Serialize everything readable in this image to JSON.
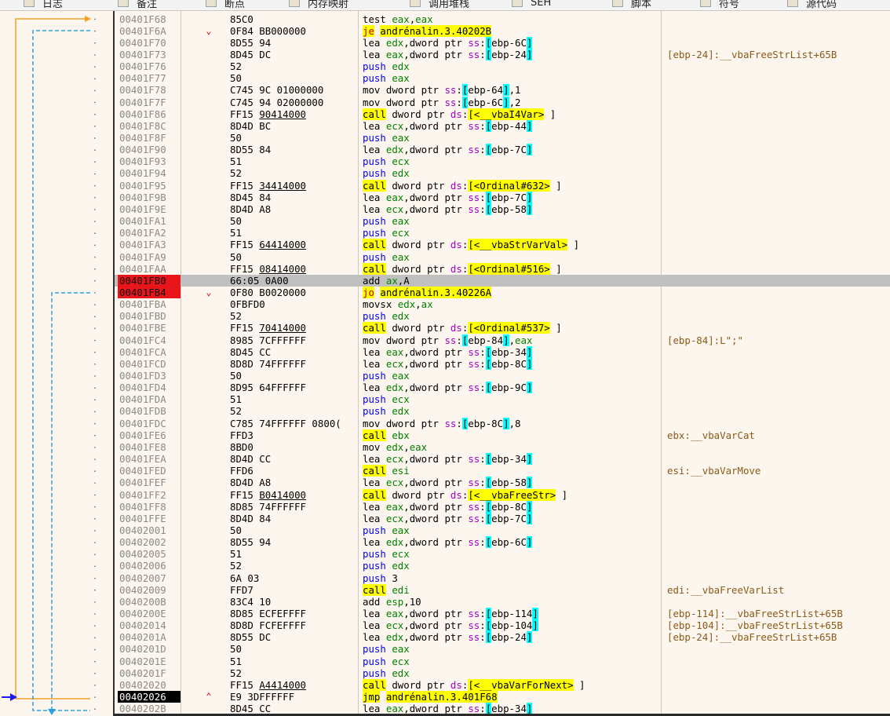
{
  "toolbar": {
    "items": [
      {
        "label": "日志",
        "icon": "log-icon"
      },
      {
        "label": "备注",
        "icon": "notes-icon"
      },
      {
        "label": "断点",
        "icon": "breakpoint-icon"
      },
      {
        "label": "内存映射",
        "icon": "memory-map-icon"
      },
      {
        "label": "调用堆栈",
        "icon": "call-stack-icon"
      },
      {
        "label": "SEH",
        "icon": "seh-icon"
      },
      {
        "label": "脚本",
        "icon": "script-icon"
      },
      {
        "label": "符号",
        "icon": "symbols-icon"
      },
      {
        "label": "源代码",
        "icon": "source-icon"
      }
    ]
  },
  "colors": {
    "background": "#fdf6ee",
    "breakpoint": "#e8151b",
    "eip": "#000000",
    "current_row": "#c0c0c0",
    "call_highlight": "#ffff00",
    "jump_arrow": "#f0a020",
    "branch_arrow": "#2aa0e8",
    "eip_arrow": "#1a1aff"
  },
  "rows": [
    {
      "addr": "00401F68",
      "bytes": "85C0",
      "m": "test",
      "ops": [
        [
          "reg",
          "eax"
        ],
        [
          "kw",
          ","
        ],
        [
          "reg",
          "eax"
        ]
      ],
      "mc": "m-test"
    },
    {
      "addr": "00401F6A",
      "bytes": "0F84 BB000000",
      "m": "je",
      "ops": [
        [
          "tgt",
          "andrénalin.3.40202B"
        ]
      ],
      "mc": "m-jcc",
      "mark": "⌄",
      "tgt_hl": true
    },
    {
      "addr": "00401F70",
      "bytes": "8D55 94",
      "m": "lea",
      "ops": [
        [
          "reg",
          "edx"
        ],
        [
          "kw",
          ",dword ptr  "
        ],
        [
          "seg",
          "ss"
        ],
        [
          "kw",
          ":"
        ],
        [
          "br",
          "[ebp-6C]"
        ]
      ],
      "mc": "m-lea"
    },
    {
      "addr": "00401F73",
      "bytes": "8D45 DC",
      "m": "lea",
      "ops": [
        [
          "reg",
          "eax"
        ],
        [
          "kw",
          ",dword ptr  "
        ],
        [
          "seg",
          "ss"
        ],
        [
          "kw",
          ":"
        ],
        [
          "br",
          "[ebp-24]"
        ]
      ],
      "mc": "m-lea",
      "cmt": "[ebp-24]:__vbaFreeStrList+65B"
    },
    {
      "addr": "00401F76",
      "bytes": "52",
      "m": "push",
      "ops": [
        [
          "reg",
          "edx"
        ]
      ],
      "mc": "m-push"
    },
    {
      "addr": "00401F77",
      "bytes": "50",
      "m": "push",
      "ops": [
        [
          "reg",
          "eax"
        ]
      ],
      "mc": "m-push"
    },
    {
      "addr": "00401F78",
      "bytes": "C745 9C 01000000",
      "m": "mov",
      "ops": [
        [
          "kw",
          "dword ptr  "
        ],
        [
          "seg",
          "ss"
        ],
        [
          "kw",
          ":"
        ],
        [
          "br",
          "[ebp-64]"
        ],
        [
          "kw",
          ",1"
        ]
      ],
      "mc": "m-mov"
    },
    {
      "addr": "00401F7F",
      "bytes": "C745 94 02000000",
      "m": "mov",
      "ops": [
        [
          "kw",
          "dword ptr  "
        ],
        [
          "seg",
          "ss"
        ],
        [
          "kw",
          ":"
        ],
        [
          "br",
          "[ebp-6C]"
        ],
        [
          "kw",
          ",2"
        ]
      ],
      "mc": "m-mov"
    },
    {
      "addr": "00401F86",
      "bytes": "FF15 ",
      "bu": "90414000",
      "m": "call",
      "ops": [
        [
          "kw",
          "dword ptr  "
        ],
        [
          "seg",
          "ds"
        ],
        [
          "kw",
          ":"
        ],
        [
          "api",
          "[<__vbaI4Var>"
        ],
        [
          "kw",
          " ]"
        ]
      ],
      "mc": "m-call"
    },
    {
      "addr": "00401F8C",
      "bytes": "8D4D BC",
      "m": "lea",
      "ops": [
        [
          "reg",
          "ecx"
        ],
        [
          "kw",
          ",dword ptr  "
        ],
        [
          "seg",
          "ss"
        ],
        [
          "kw",
          ":"
        ],
        [
          "br",
          "[ebp-44]"
        ]
      ],
      "mc": "m-lea"
    },
    {
      "addr": "00401F8F",
      "bytes": "50",
      "m": "push",
      "ops": [
        [
          "reg",
          "eax"
        ]
      ],
      "mc": "m-push"
    },
    {
      "addr": "00401F90",
      "bytes": "8D55 84",
      "m": "lea",
      "ops": [
        [
          "reg",
          "edx"
        ],
        [
          "kw",
          ",dword ptr  "
        ],
        [
          "seg",
          "ss"
        ],
        [
          "kw",
          ":"
        ],
        [
          "br",
          "[ebp-7C]"
        ]
      ],
      "mc": "m-lea"
    },
    {
      "addr": "00401F93",
      "bytes": "51",
      "m": "push",
      "ops": [
        [
          "reg",
          "ecx"
        ]
      ],
      "mc": "m-push"
    },
    {
      "addr": "00401F94",
      "bytes": "52",
      "m": "push",
      "ops": [
        [
          "reg",
          "edx"
        ]
      ],
      "mc": "m-push"
    },
    {
      "addr": "00401F95",
      "bytes": "FF15 ",
      "bu": "34414000",
      "m": "call",
      "ops": [
        [
          "kw",
          "dword ptr  "
        ],
        [
          "seg",
          "ds"
        ],
        [
          "kw",
          ":"
        ],
        [
          "api",
          "[<Ordinal#632>"
        ],
        [
          "kw",
          " ]"
        ]
      ],
      "mc": "m-call"
    },
    {
      "addr": "00401F9B",
      "bytes": "8D45 84",
      "m": "lea",
      "ops": [
        [
          "reg",
          "eax"
        ],
        [
          "kw",
          ",dword ptr  "
        ],
        [
          "seg",
          "ss"
        ],
        [
          "kw",
          ":"
        ],
        [
          "br",
          "[ebp-7C]"
        ]
      ],
      "mc": "m-lea"
    },
    {
      "addr": "00401F9E",
      "bytes": "8D4D A8",
      "m": "lea",
      "ops": [
        [
          "reg",
          "ecx"
        ],
        [
          "kw",
          ",dword ptr  "
        ],
        [
          "seg",
          "ss"
        ],
        [
          "kw",
          ":"
        ],
        [
          "br",
          "[ebp-58]"
        ]
      ],
      "mc": "m-lea"
    },
    {
      "addr": "00401FA1",
      "bytes": "50",
      "m": "push",
      "ops": [
        [
          "reg",
          "eax"
        ]
      ],
      "mc": "m-push"
    },
    {
      "addr": "00401FA2",
      "bytes": "51",
      "m": "push",
      "ops": [
        [
          "reg",
          "ecx"
        ]
      ],
      "mc": "m-push"
    },
    {
      "addr": "00401FA3",
      "bytes": "FF15 ",
      "bu": "64414000",
      "m": "call",
      "ops": [
        [
          "kw",
          "dword ptr  "
        ],
        [
          "seg",
          "ds"
        ],
        [
          "kw",
          ":"
        ],
        [
          "api",
          "[<__vbaStrVarVal>"
        ],
        [
          "kw",
          " ]"
        ]
      ],
      "mc": "m-call"
    },
    {
      "addr": "00401FA9",
      "bytes": "50",
      "m": "push",
      "ops": [
        [
          "reg",
          "eax"
        ]
      ],
      "mc": "m-push"
    },
    {
      "addr": "00401FAA",
      "bytes": "FF15 ",
      "bu": "08414000",
      "m": "call",
      "ops": [
        [
          "kw",
          "dword ptr  "
        ],
        [
          "seg",
          "ds"
        ],
        [
          "kw",
          ":"
        ],
        [
          "api",
          "[<Ordinal#516>"
        ],
        [
          "kw",
          " ]"
        ]
      ],
      "mc": "m-call"
    },
    {
      "addr": "00401FB0",
      "bytes": "66:05 0A00",
      "m": "add",
      "ops": [
        [
          "reg",
          "ax"
        ],
        [
          "kw",
          ",A"
        ]
      ],
      "mc": "m-add",
      "bp": true,
      "cur": true
    },
    {
      "addr": "00401FB4",
      "bytes": "0F80 B0020000",
      "m": "jo",
      "ops": [
        [
          "tgt",
          "andrénalin.3.40226A"
        ]
      ],
      "mc": "m-jcc",
      "bp": true,
      "mark": "⌄",
      "tgt_hl": true
    },
    {
      "addr": "00401FBA",
      "bytes": "0FBFD0",
      "m": "movsx",
      "ops": [
        [
          "reg",
          "edx"
        ],
        [
          "kw",
          ","
        ],
        [
          "reg",
          "ax"
        ]
      ],
      "mc": "m-movsx"
    },
    {
      "addr": "00401FBD",
      "bytes": "52",
      "m": "push",
      "ops": [
        [
          "reg",
          "edx"
        ]
      ],
      "mc": "m-push"
    },
    {
      "addr": "00401FBE",
      "bytes": "FF15 ",
      "bu": "70414000",
      "m": "call",
      "ops": [
        [
          "kw",
          "dword ptr  "
        ],
        [
          "seg",
          "ds"
        ],
        [
          "kw",
          ":"
        ],
        [
          "api",
          "[<Ordinal#537>"
        ],
        [
          "kw",
          " ]"
        ]
      ],
      "mc": "m-call"
    },
    {
      "addr": "00401FC4",
      "bytes": "8985 7CFFFFFF",
      "m": "mov",
      "ops": [
        [
          "kw",
          "dword ptr  "
        ],
        [
          "seg",
          "ss"
        ],
        [
          "kw",
          ":"
        ],
        [
          "br",
          "[ebp-84]"
        ],
        [
          "kw",
          ","
        ],
        [
          "reg",
          "eax"
        ]
      ],
      "mc": "m-mov",
      "cmt": "[ebp-84]:L\";\""
    },
    {
      "addr": "00401FCA",
      "bytes": "8D45 CC",
      "m": "lea",
      "ops": [
        [
          "reg",
          "eax"
        ],
        [
          "kw",
          ",dword ptr  "
        ],
        [
          "seg",
          "ss"
        ],
        [
          "kw",
          ":"
        ],
        [
          "br",
          "[ebp-34]"
        ]
      ],
      "mc": "m-lea"
    },
    {
      "addr": "00401FCD",
      "bytes": "8D8D 74FFFFFF",
      "m": "lea",
      "ops": [
        [
          "reg",
          "ecx"
        ],
        [
          "kw",
          ",dword ptr  "
        ],
        [
          "seg",
          "ss"
        ],
        [
          "kw",
          ":"
        ],
        [
          "br",
          "[ebp-8C]"
        ]
      ],
      "mc": "m-lea"
    },
    {
      "addr": "00401FD3",
      "bytes": "50",
      "m": "push",
      "ops": [
        [
          "reg",
          "eax"
        ]
      ],
      "mc": "m-push"
    },
    {
      "addr": "00401FD4",
      "bytes": "8D95 64FFFFFF",
      "m": "lea",
      "ops": [
        [
          "reg",
          "edx"
        ],
        [
          "kw",
          ",dword ptr  "
        ],
        [
          "seg",
          "ss"
        ],
        [
          "kw",
          ":"
        ],
        [
          "br",
          "[ebp-9C]"
        ]
      ],
      "mc": "m-lea"
    },
    {
      "addr": "00401FDA",
      "bytes": "51",
      "m": "push",
      "ops": [
        [
          "reg",
          "ecx"
        ]
      ],
      "mc": "m-push"
    },
    {
      "addr": "00401FDB",
      "bytes": "52",
      "m": "push",
      "ops": [
        [
          "reg",
          "edx"
        ]
      ],
      "mc": "m-push"
    },
    {
      "addr": "00401FDC",
      "bytes": "C785 74FFFFFF 0800(",
      "m": "mov",
      "ops": [
        [
          "kw",
          "dword ptr  "
        ],
        [
          "seg",
          "ss"
        ],
        [
          "kw",
          ":"
        ],
        [
          "br",
          "[ebp-8C]"
        ],
        [
          "kw",
          ",8"
        ]
      ],
      "mc": "m-mov"
    },
    {
      "addr": "00401FE6",
      "bytes": "FFD3",
      "m": "call",
      "ops": [
        [
          "reg",
          "ebx"
        ]
      ],
      "mc": "m-call",
      "cmt": "ebx:__vbaVarCat"
    },
    {
      "addr": "00401FE8",
      "bytes": "8BD0",
      "m": "mov",
      "ops": [
        [
          "reg",
          "edx"
        ],
        [
          "kw",
          ","
        ],
        [
          "reg",
          "eax"
        ]
      ],
      "mc": "m-mov"
    },
    {
      "addr": "00401FEA",
      "bytes": "8D4D CC",
      "m": "lea",
      "ops": [
        [
          "reg",
          "ecx"
        ],
        [
          "kw",
          ",dword ptr  "
        ],
        [
          "seg",
          "ss"
        ],
        [
          "kw",
          ":"
        ],
        [
          "br",
          "[ebp-34]"
        ]
      ],
      "mc": "m-lea"
    },
    {
      "addr": "00401FED",
      "bytes": "FFD6",
      "m": "call",
      "ops": [
        [
          "reg",
          "esi"
        ]
      ],
      "mc": "m-call",
      "cmt": "esi:__vbaVarMove"
    },
    {
      "addr": "00401FEF",
      "bytes": "8D4D A8",
      "m": "lea",
      "ops": [
        [
          "reg",
          "ecx"
        ],
        [
          "kw",
          ",dword ptr  "
        ],
        [
          "seg",
          "ss"
        ],
        [
          "kw",
          ":"
        ],
        [
          "br",
          "[ebp-58]"
        ]
      ],
      "mc": "m-lea"
    },
    {
      "addr": "00401FF2",
      "bytes": "FF15 ",
      "bu": "B0414000",
      "m": "call",
      "ops": [
        [
          "kw",
          "dword ptr  "
        ],
        [
          "seg",
          "ds"
        ],
        [
          "kw",
          ":"
        ],
        [
          "api",
          "[<__vbaFreeStr>"
        ],
        [
          "kw",
          " ]"
        ]
      ],
      "mc": "m-call"
    },
    {
      "addr": "00401FF8",
      "bytes": "8D85 74FFFFFF",
      "m": "lea",
      "ops": [
        [
          "reg",
          "eax"
        ],
        [
          "kw",
          ",dword ptr  "
        ],
        [
          "seg",
          "ss"
        ],
        [
          "kw",
          ":"
        ],
        [
          "br",
          "[ebp-8C]"
        ]
      ],
      "mc": "m-lea"
    },
    {
      "addr": "00401FFE",
      "bytes": "8D4D 84",
      "m": "lea",
      "ops": [
        [
          "reg",
          "ecx"
        ],
        [
          "kw",
          ",dword ptr  "
        ],
        [
          "seg",
          "ss"
        ],
        [
          "kw",
          ":"
        ],
        [
          "br",
          "[ebp-7C]"
        ]
      ],
      "mc": "m-lea"
    },
    {
      "addr": "00402001",
      "bytes": "50",
      "m": "push",
      "ops": [
        [
          "reg",
          "eax"
        ]
      ],
      "mc": "m-push"
    },
    {
      "addr": "00402002",
      "bytes": "8D55 94",
      "m": "lea",
      "ops": [
        [
          "reg",
          "edx"
        ],
        [
          "kw",
          ",dword ptr  "
        ],
        [
          "seg",
          "ss"
        ],
        [
          "kw",
          ":"
        ],
        [
          "br",
          "[ebp-6C]"
        ]
      ],
      "mc": "m-lea"
    },
    {
      "addr": "00402005",
      "bytes": "51",
      "m": "push",
      "ops": [
        [
          "reg",
          "ecx"
        ]
      ],
      "mc": "m-push"
    },
    {
      "addr": "00402006",
      "bytes": "52",
      "m": "push",
      "ops": [
        [
          "reg",
          "edx"
        ]
      ],
      "mc": "m-push"
    },
    {
      "addr": "00402007",
      "bytes": "6A 03",
      "m": "push",
      "ops": [
        [
          "num",
          "3"
        ]
      ],
      "mc": "m-push"
    },
    {
      "addr": "00402009",
      "bytes": "FFD7",
      "m": "call",
      "ops": [
        [
          "reg",
          "edi"
        ]
      ],
      "mc": "m-call",
      "cmt": "edi:__vbaFreeVarList"
    },
    {
      "addr": "0040200B",
      "bytes": "83C4 10",
      "m": "add",
      "ops": [
        [
          "reg",
          "esp"
        ],
        [
          "kw",
          ",10"
        ]
      ],
      "mc": "m-add"
    },
    {
      "addr": "0040200E",
      "bytes": "8D85 ECFEFFFF",
      "m": "lea",
      "ops": [
        [
          "reg",
          "eax"
        ],
        [
          "kw",
          ",dword ptr  "
        ],
        [
          "seg",
          "ss"
        ],
        [
          "kw",
          ":"
        ],
        [
          "br",
          "[ebp-114]"
        ]
      ],
      "mc": "m-lea",
      "cmt": "[ebp-114]:__vbaFreeStrList+65B"
    },
    {
      "addr": "00402014",
      "bytes": "8D8D FCFEFFFF",
      "m": "lea",
      "ops": [
        [
          "reg",
          "ecx"
        ],
        [
          "kw",
          ",dword ptr  "
        ],
        [
          "seg",
          "ss"
        ],
        [
          "kw",
          ":"
        ],
        [
          "br",
          "[ebp-104]"
        ]
      ],
      "mc": "m-lea",
      "cmt": "[ebp-104]:__vbaFreeStrList+65B"
    },
    {
      "addr": "0040201A",
      "bytes": "8D55 DC",
      "m": "lea",
      "ops": [
        [
          "reg",
          "edx"
        ],
        [
          "kw",
          ",dword ptr  "
        ],
        [
          "seg",
          "ss"
        ],
        [
          "kw",
          ":"
        ],
        [
          "br",
          "[ebp-24]"
        ]
      ],
      "mc": "m-lea",
      "cmt": "[ebp-24]:__vbaFreeStrList+65B"
    },
    {
      "addr": "0040201D",
      "bytes": "50",
      "m": "push",
      "ops": [
        [
          "reg",
          "eax"
        ]
      ],
      "mc": "m-push"
    },
    {
      "addr": "0040201E",
      "bytes": "51",
      "m": "push",
      "ops": [
        [
          "reg",
          "ecx"
        ]
      ],
      "mc": "m-push"
    },
    {
      "addr": "0040201F",
      "bytes": "52",
      "m": "push",
      "ops": [
        [
          "reg",
          "edx"
        ]
      ],
      "mc": "m-push"
    },
    {
      "addr": "00402020",
      "bytes": "FF15 ",
      "bu": "A4414000",
      "m": "call",
      "ops": [
        [
          "kw",
          "dword ptr  "
        ],
        [
          "seg",
          "ds"
        ],
        [
          "kw",
          ":"
        ],
        [
          "api",
          "[<__vbaVarForNext>"
        ],
        [
          "kw",
          " ]"
        ]
      ],
      "mc": "m-call"
    },
    {
      "addr": "00402026",
      "bytes": "E9 3DFFFFFF",
      "m": "jmp",
      "ops": [
        [
          "tgt",
          "andrénalin.3.401F68"
        ]
      ],
      "mc": "m-jmp",
      "eip": true,
      "mark": "⌃",
      "tgt_hl": true
    },
    {
      "addr": "0040202B",
      "bytes": "8D45 CC",
      "m": "lea",
      "ops": [
        [
          "reg",
          "eax"
        ],
        [
          "kw",
          ",dword ptr  "
        ],
        [
          "seg",
          "ss"
        ],
        [
          "kw",
          ":"
        ],
        [
          "br",
          "[ebp-34]"
        ]
      ],
      "mc": "m-lea"
    }
  ]
}
